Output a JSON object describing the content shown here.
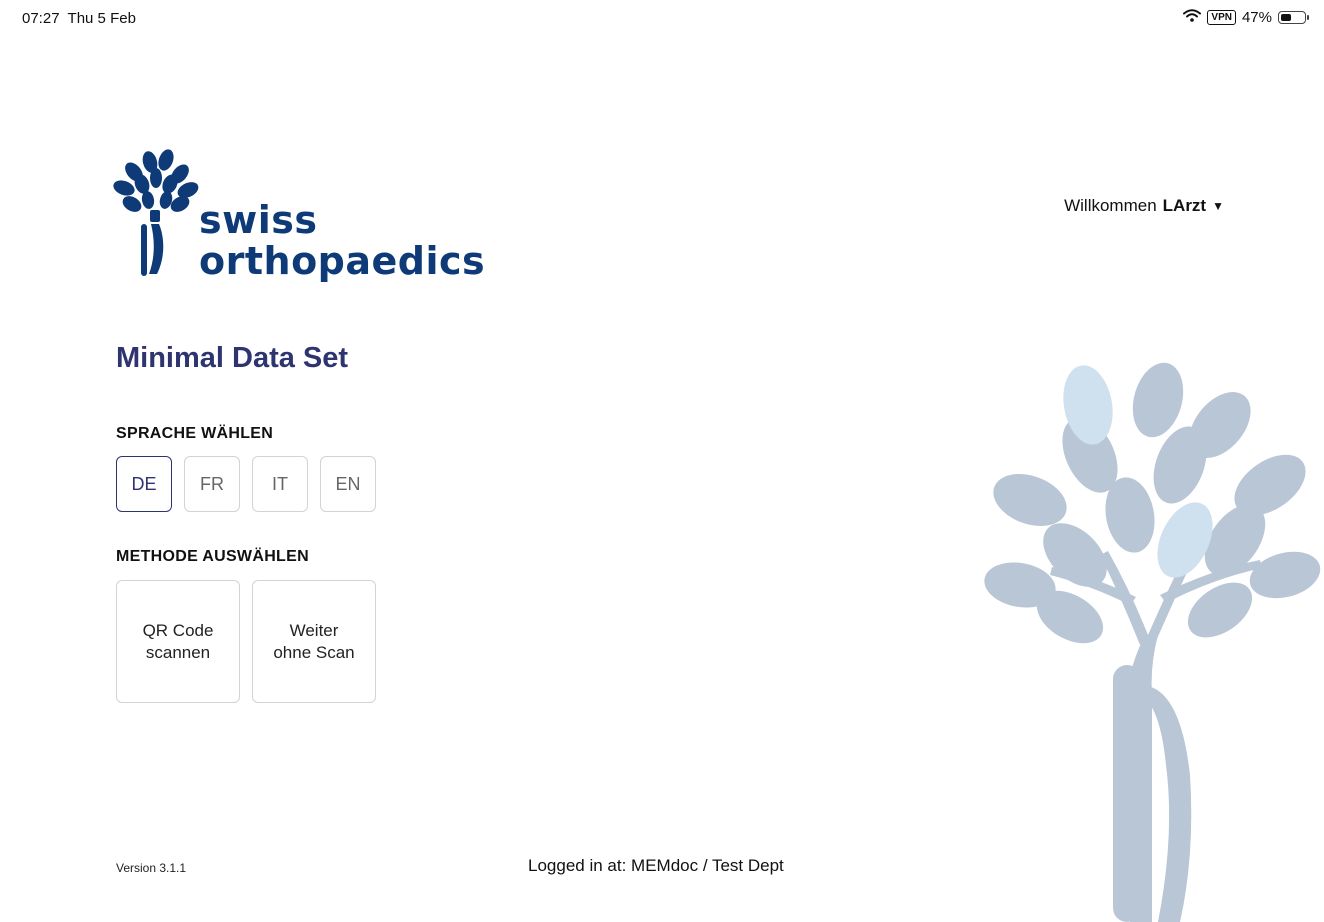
{
  "status_bar": {
    "time": "07:27",
    "date": "Thu 5 Feb",
    "vpn": "VPN",
    "battery_percent": "47%",
    "battery_level": 0.47
  },
  "header": {
    "logo_line1": "swiss",
    "logo_line2": "orthopaedics",
    "welcome_prefix": "Willkommen",
    "welcome_user": "LArzt",
    "welcome_caret": "▼"
  },
  "main": {
    "title": "Minimal Data Set",
    "language_section": {
      "label": "SPRACHE WÄHLEN",
      "options": [
        "DE",
        "FR",
        "IT",
        "EN"
      ],
      "selected": "DE"
    },
    "method_section": {
      "label": "METHODE AUSWÄHLEN",
      "options": [
        {
          "line1": "QR Code",
          "line2": "scannen"
        },
        {
          "line1": "Weiter",
          "line2": "ohne Scan"
        }
      ]
    }
  },
  "footer": {
    "version": "Version  3.1.1",
    "logged_in": "Logged in at: MEMdoc / Test Dept"
  },
  "colors": {
    "brand_blue": "#0f3a78",
    "title_navy": "#2e3470",
    "tree_grey": "#b8c6d6",
    "tree_light": "#cfe0ee"
  }
}
